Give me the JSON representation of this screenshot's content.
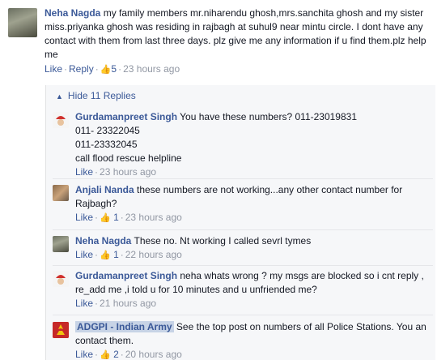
{
  "top_comment": {
    "author": "Neha Nagda",
    "text": "my family members mr.niharendu ghosh,mrs.sanchita ghosh and my sister miss.priyanka ghosh was residing in rajbagh at suhul9 near mintu circle. I dont have any contact with them from last three days. plz give me any information if u find them.plz help me",
    "like": "Like",
    "reply": "Reply",
    "likes_count": "5",
    "time": "23 hours ago"
  },
  "replies_toggle": {
    "label": "Hide 11 Replies"
  },
  "replies": [
    {
      "author": "Gurdamanpreet Singh",
      "lines": [
        "You have these numbers? 011-23019831",
        "011- 23322045",
        "011-23332045",
        "call flood rescue helpline"
      ],
      "like": "Like",
      "time": "23 hours ago"
    },
    {
      "author": "Anjali Nanda",
      "text": "these numbers are not working...any other contact number for Rajbagh?",
      "like": "Like",
      "likes_count": "1",
      "time": "23 hours ago"
    },
    {
      "author": "Neha Nagda",
      "text": "These no. Nt working I called sevrl tymes",
      "like": "Like",
      "likes_count": "1",
      "time": "22 hours ago"
    },
    {
      "author": "Gurdamanpreet Singh",
      "text": "neha whats wrong ? my msgs are blocked so i cnt reply , re_add me ,i told u for 10 minutes and u unfriended me?",
      "like": "Like",
      "time": "21 hours ago"
    },
    {
      "author": "ADGPI - Indian Army",
      "text": "See the top post on numbers of all Police Stations. You an contact them.",
      "like": "Like",
      "likes_count": "2",
      "time": "20 hours ago"
    }
  ]
}
